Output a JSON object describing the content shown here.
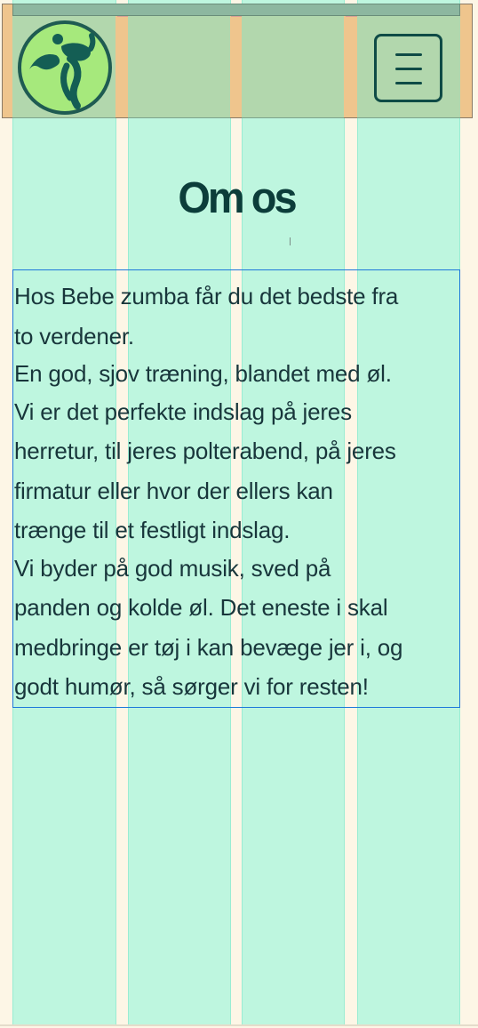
{
  "header": {
    "logo_icon": "dancer-logo-icon",
    "menu_icon": "hamburger-menu-icon"
  },
  "main": {
    "title": "Om os",
    "paragraphs": [
      "Hos Bebe zumba får du det bedste fra\nto verdener.",
      "En god, sjov træning, blandet med øl.",
      "Vi er det perfekte indslag på jeres\nherretur, til jeres polterabend, på jeres\nfirmatur eller hvor der ellers kan\ntrænge til et festligt indslag.",
      "Vi byder på god musik, sved på\npanden og kolde øl. Det eneste i skal\nmedbringe er tøj i kan bevæge jer i, og\ngodt humør, så sørger vi for resten!"
    ]
  },
  "colors": {
    "page_background": "#fdf6e6",
    "grid_columns": "#a5f5dc",
    "header_background": "#efc58d",
    "header_cells": "#b2d7ad",
    "brand_dark": "#0c3d3a",
    "logo_green": "#a6e97c",
    "selection_outline": "#1e78db"
  }
}
